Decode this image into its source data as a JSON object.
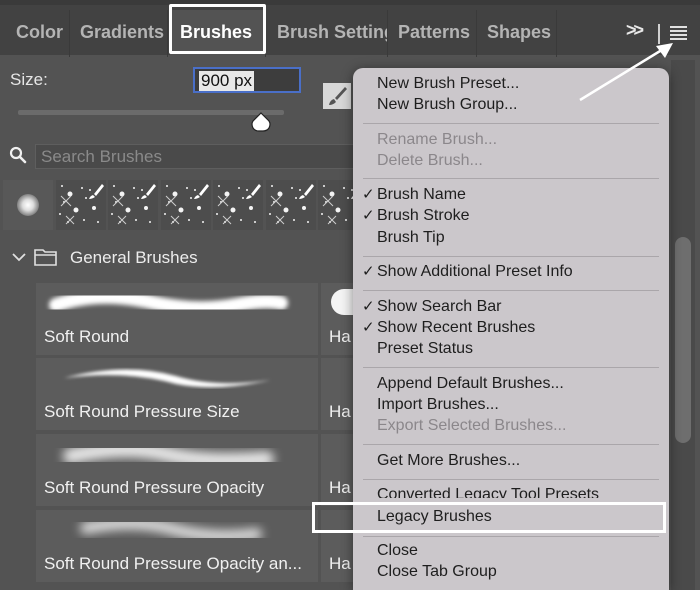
{
  "tabs": [
    {
      "label": "Color",
      "active": false
    },
    {
      "label": "Gradients",
      "active": false
    },
    {
      "label": "Brushes",
      "active": true
    },
    {
      "label": "Brush Settings",
      "active": false
    },
    {
      "label": "Patterns",
      "active": false
    },
    {
      "label": "Shapes",
      "active": false
    }
  ],
  "tabbar": {
    "overflow_icon": "double-chevron-right-icon",
    "menu_icon": "hamburger-menu-icon",
    "overflow_label": ">>"
  },
  "size": {
    "label": "Size:",
    "value": "900 px",
    "slider_fraction": 0.9
  },
  "search": {
    "placeholder": "Search Brushes"
  },
  "recent_brushes": {
    "count": 7
  },
  "group": {
    "label": "General Brushes",
    "expanded": true
  },
  "brushes": [
    {
      "name": "Soft Round"
    },
    {
      "name": "Soft Round Pressure Size"
    },
    {
      "name": "Soft Round Pressure Opacity"
    },
    {
      "name": "Soft Round Pressure Opacity an..."
    }
  ],
  "side_brushes": [
    {
      "name": "Ha"
    },
    {
      "name": "Ha"
    },
    {
      "name": "Ha"
    },
    {
      "name": "Ha"
    }
  ],
  "menu": {
    "items": [
      {
        "label": "New Brush Preset...",
        "checked": false,
        "disabled": false
      },
      {
        "label": "New Brush Group...",
        "checked": false,
        "disabled": false
      },
      {
        "label": "Rename Brush...",
        "checked": false,
        "disabled": true
      },
      {
        "label": "Delete Brush...",
        "checked": false,
        "disabled": true
      },
      {
        "label": "Brush Name",
        "checked": true,
        "disabled": false
      },
      {
        "label": "Brush Stroke",
        "checked": true,
        "disabled": false
      },
      {
        "label": "Brush Tip",
        "checked": false,
        "disabled": false
      },
      {
        "label": "Show Additional Preset Info",
        "checked": true,
        "disabled": false
      },
      {
        "label": "Show Search Bar",
        "checked": true,
        "disabled": false
      },
      {
        "label": "Show Recent Brushes",
        "checked": true,
        "disabled": false
      },
      {
        "label": "Preset Status",
        "checked": false,
        "disabled": false
      },
      {
        "label": "Append Default Brushes...",
        "checked": false,
        "disabled": false
      },
      {
        "label": "Import Brushes...",
        "checked": false,
        "disabled": false
      },
      {
        "label": "Export Selected Brushes...",
        "checked": false,
        "disabled": true
      },
      {
        "label": "Get More Brushes...",
        "checked": false,
        "disabled": false
      },
      {
        "label": "Converted Legacy Tool Presets",
        "checked": false,
        "disabled": false
      },
      {
        "label": "Legacy Brushes",
        "checked": false,
        "disabled": false,
        "highlighted": true
      },
      {
        "label": "Close",
        "checked": false,
        "disabled": false
      },
      {
        "label": "Close Tab Group",
        "checked": false,
        "disabled": false
      }
    ],
    "check_glyph": "✓"
  },
  "colors": {
    "panel_bg": "#535353",
    "tab_bar_bg": "#424242",
    "menu_bg": "#cbc7cb",
    "focus_blue": "#4a6fc8",
    "highlight_outline": "#ffffff"
  }
}
